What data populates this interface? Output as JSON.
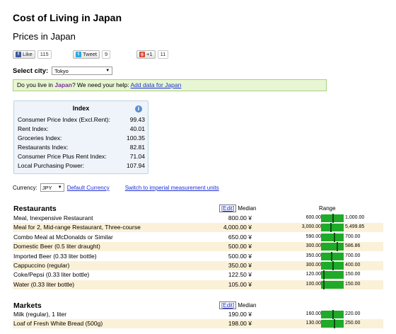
{
  "page": {
    "title": "Cost of Living in Japan",
    "subtitle": "Prices in Japan"
  },
  "social": {
    "like_label": "Like",
    "like_count": "115",
    "tweet_label": "Tweet",
    "tweet_count": "9",
    "gplus_label": "+1",
    "gplus_count": "11"
  },
  "city_select": {
    "label": "Select city:",
    "value": "Tokyo"
  },
  "notice": {
    "prefix": "Do you live in ",
    "country": "Japan",
    "middle": "? We need your help: ",
    "link": "Add data for Japan"
  },
  "index_box": {
    "heading": "Index",
    "rows": [
      {
        "label": "Consumer Price Index (Excl.Rent):",
        "value": "99.43"
      },
      {
        "label": "Rent Index:",
        "value": "40.01"
      },
      {
        "label": "Groceries Index:",
        "value": "100.35"
      },
      {
        "label": "Restaurants Index:",
        "value": "82.81"
      },
      {
        "label": "Consumer Price Plus Rent Index:",
        "value": "71.04"
      },
      {
        "label": "Local Purchasing Power:",
        "value": "107.94"
      }
    ]
  },
  "currency": {
    "label": "Currency:",
    "value": "JPY",
    "default_link": "Default Currency",
    "imperial_link": "Switch to imperial measurement units"
  },
  "restaurants": {
    "title": "Restaurants",
    "edit_label": "Edit",
    "median_label": "Median",
    "range_label": "Range",
    "items": [
      {
        "name": "Meal, Inexpensive Restaurant",
        "median": "800.00 ¥",
        "range_low": "600.00",
        "range_high": "1,000.00",
        "marker": 0.5
      },
      {
        "name": "Meal for 2, Mid-range Restaurant, Three-course",
        "median": "4,000.00 ¥",
        "range_low": "3,000.00",
        "range_high": "5,499.85",
        "marker": 0.4
      },
      {
        "name": "Combo Meal at McDonalds or Similar",
        "median": "650.00 ¥",
        "range_low": "590.00",
        "range_high": "700.00",
        "marker": 0.55
      },
      {
        "name": "Domestic Beer (0.5 liter draught)",
        "median": "500.00 ¥",
        "range_low": "300.00",
        "range_high": "586.86",
        "marker": 0.7
      },
      {
        "name": "Imported Beer (0.33 liter bottle)",
        "median": "500.00 ¥",
        "range_low": "350.00",
        "range_high": "700.00",
        "marker": 0.43
      },
      {
        "name": "Cappuccino (regular)",
        "median": "350.00 ¥",
        "range_low": "300.00",
        "range_high": "400.00",
        "marker": 0.5
      },
      {
        "name": "Coke/Pepsi (0.33 liter bottle)",
        "median": "122.50 ¥",
        "range_low": "120.00",
        "range_high": "150.00",
        "marker": 0.08
      },
      {
        "name": "Water (0.33 liter bottle)",
        "median": "105.00 ¥",
        "range_low": "100.00",
        "range_high": "150.00",
        "marker": 0.1
      }
    ]
  },
  "markets": {
    "title": "Markets",
    "edit_label": "Edit",
    "median_label": "Median",
    "items": [
      {
        "name": "Milk (regular), 1 liter",
        "median": "190.00 ¥",
        "range_low": "160.00",
        "range_high": "220.00",
        "marker": 0.5
      },
      {
        "name": "Loaf of Fresh White Bread (500g)",
        "median": "198.00 ¥",
        "range_low": "130.00",
        "range_high": "250.00",
        "marker": 0.57
      }
    ]
  },
  "colors": {
    "bar": "#1faa2a",
    "marker": "#0d4d12",
    "row_alt": "#fbf1d8",
    "link": "#1d2fd6",
    "notice_bg": "#e8f6d3",
    "index_bg": "#eef4fa"
  }
}
